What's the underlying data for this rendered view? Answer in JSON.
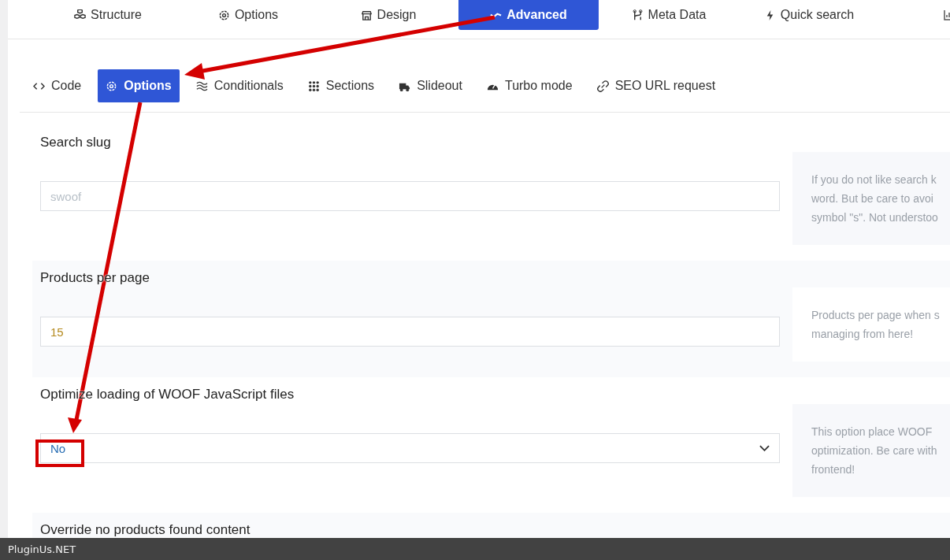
{
  "top_tabs": [
    {
      "label": "Structure",
      "selected": false
    },
    {
      "label": "Options",
      "selected": false
    },
    {
      "label": "Design",
      "selected": false
    },
    {
      "label": "Advanced",
      "selected": true
    },
    {
      "label": "Meta Data",
      "selected": false
    },
    {
      "label": "Quick search",
      "selected": false
    }
  ],
  "sub_tabs": [
    {
      "label": "Code",
      "selected": false
    },
    {
      "label": "Options",
      "selected": true
    },
    {
      "label": "Conditionals",
      "selected": false
    },
    {
      "label": "Sections",
      "selected": false
    },
    {
      "label": "Slideout",
      "selected": false
    },
    {
      "label": "Turbo mode",
      "selected": false
    },
    {
      "label": "SEO URL request",
      "selected": false
    }
  ],
  "settings": [
    {
      "label": "Search slug",
      "kind": "text",
      "placeholder": "swoof",
      "help": [
        "If you do not like search k",
        "word. But be care to avoi",
        "symbol \"s\". Not understoo"
      ]
    },
    {
      "label": "Products per page",
      "kind": "text",
      "value": "15",
      "help": [
        "Products per page when s",
        "managing from here!"
      ]
    },
    {
      "label": "Optimize loading of WOOF JavaScript files",
      "kind": "select",
      "value": "No",
      "help": [
        "This option place WOOF",
        "optimization. Be care with",
        "frontend!"
      ]
    },
    {
      "label": "Override no products found content",
      "kind": "none"
    }
  ],
  "footer": {
    "caption": "PluginUs.NET"
  }
}
